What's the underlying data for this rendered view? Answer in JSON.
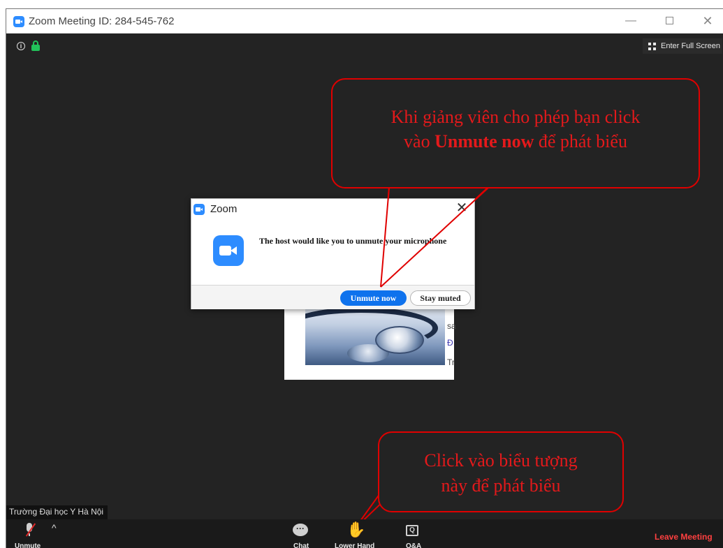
{
  "window": {
    "title": "Zoom Meeting ID: 284-545-762"
  },
  "top_bar": {
    "fullscreen_label": "Enter Full Screen"
  },
  "shared_content": {
    "side_texts": [
      "sa",
      "Đ",
      "Tr"
    ]
  },
  "annotations": {
    "top_line1": "Khi giảng viên cho phép bạn click",
    "top_line2_prefix": "vào ",
    "top_line2_bold": "Unmute now",
    "top_line2_suffix": " để phát biểu",
    "bottom_line1": "Click vào biểu tượng",
    "bottom_line2": "này để phát biểu",
    "color": "#e4191b"
  },
  "dialog": {
    "title": "Zoom",
    "message": "The host would like you to unmute your microphone",
    "primary_button": "Unmute now",
    "secondary_button": "Stay muted"
  },
  "participant": {
    "name": "Trường Đại học Y Hà Nội"
  },
  "toolbar": {
    "unmute_label": "Unmute",
    "chat_label": "Chat",
    "raise_hand_label": "Lower Hand",
    "qa_label": "Q&A",
    "leave_label": "Leave Meeting"
  },
  "colors": {
    "zoom_blue": "#2d8cff",
    "button_blue": "#0e72ed",
    "hand_green": "#2fbf4b",
    "leave_red": "#ff4040"
  }
}
